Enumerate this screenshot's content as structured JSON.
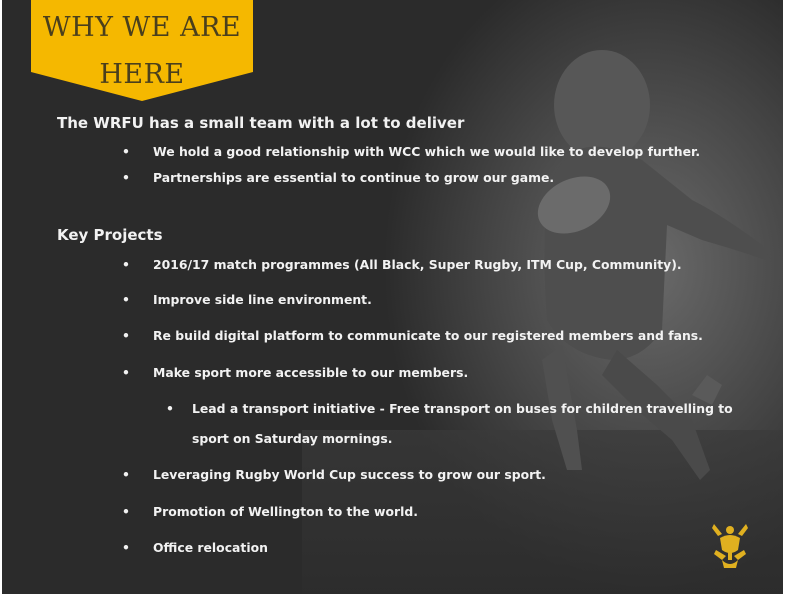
{
  "banner": {
    "line1": "WHY WE ARE",
    "line2": "HERE"
  },
  "intro": {
    "heading": "The WRFU  has a small team with a lot to deliver",
    "bullets": [
      "We hold a good relationship with WCC which we would like to develop further.",
      "Partnerships are essential to continue to grow our game."
    ]
  },
  "projects": {
    "heading": "Key Projects",
    "bullets": [
      "2016/17 match programmes (All Black, Super Rugby, ITM Cup, Community).",
      "Improve side line environment.",
      "Re build digital platform to communicate to our registered members and fans.",
      "Make sport more accessible to our members.",
      "Lead a transport initiative - Free transport on buses for children travelling to",
      "sport on Saturday mornings.",
      "Leveraging Rugby World Cup success to grow our sport.",
      "Promotion of Wellington to the world.",
      "Office relocation"
    ]
  },
  "bullet_glyph": "•",
  "colors": {
    "banner": "#f5b800",
    "background": "#2b2b2b",
    "text": "#f2f2f2",
    "logo": "#e0b020"
  }
}
